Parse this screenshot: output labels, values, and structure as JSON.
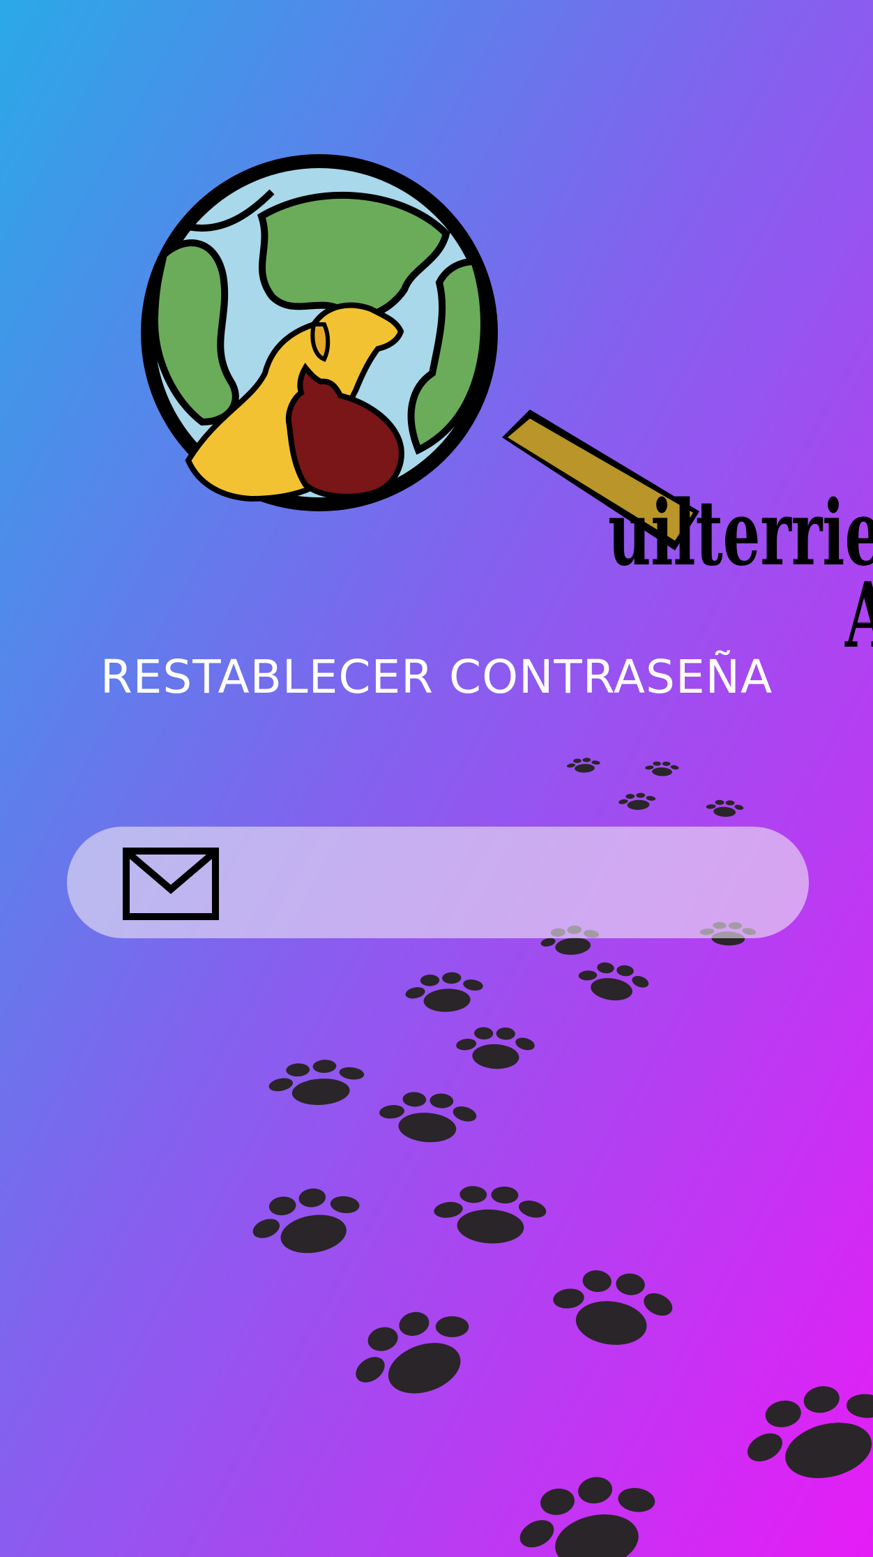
{
  "theme": {
    "gradient_start": "#2aa9e7",
    "gradient_mid": "#8d5ef0",
    "gradient_end": "#e61cf6",
    "paw_color": "#2a2528",
    "title_color": "#ffffff"
  },
  "logo": {
    "line1": "uilterrier",
    "line2": "App",
    "icons": [
      "globe-icon",
      "magnifying-glass-icon",
      "dog-icon",
      "cat-icon"
    ]
  },
  "screen": {
    "title": "RESTABLECER CONTRASEÑA"
  },
  "email_field": {
    "icon": "mail-icon",
    "value": "",
    "placeholder": ""
  },
  "background": {
    "decoration": "paw-prints"
  }
}
